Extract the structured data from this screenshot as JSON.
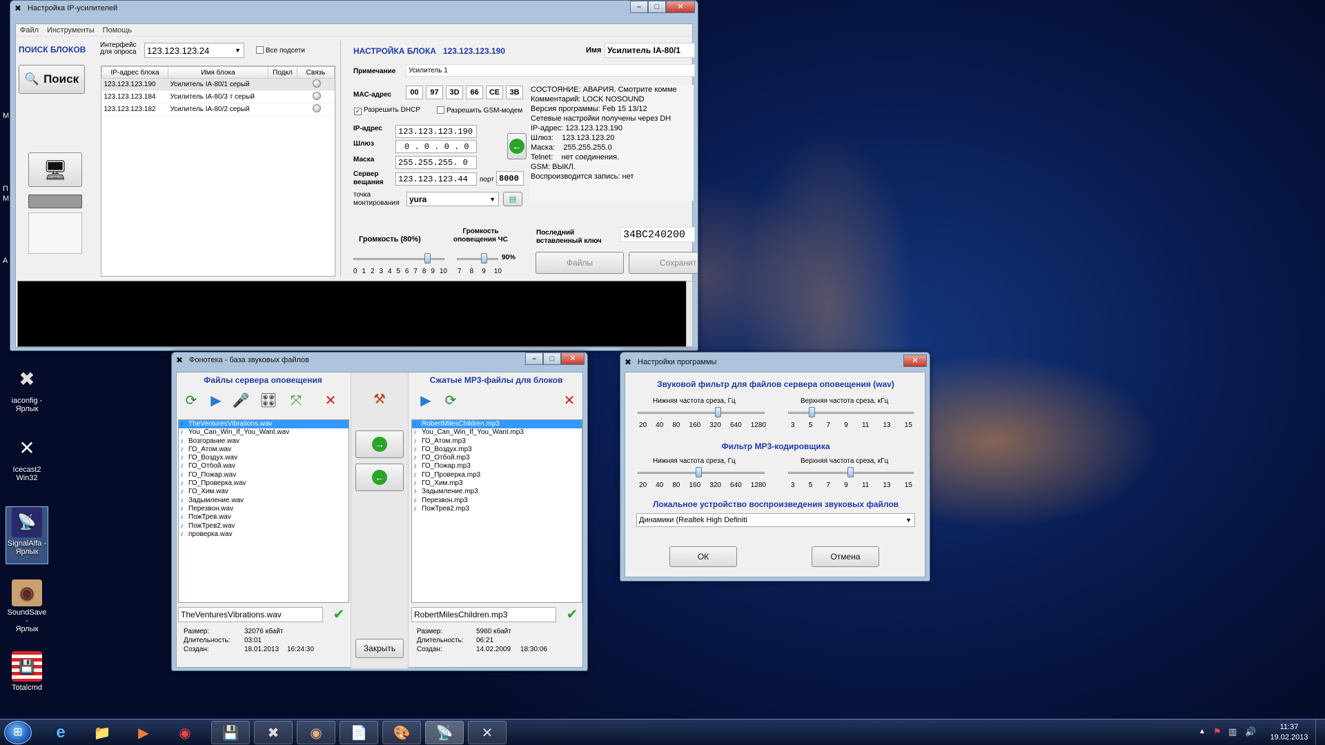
{
  "desktop": {
    "icons": [
      {
        "label1": "iaconfig -",
        "label2": "Ярлык"
      },
      {
        "label1": "Icecast2",
        "label2": "Win32"
      },
      {
        "label1": "SignalAlfa -",
        "label2": "Ярлык"
      },
      {
        "label1": "SoundSave -",
        "label2": "Ярлык"
      },
      {
        "label1": "Totalcmd",
        "label2": ""
      }
    ],
    "edge_letters": [
      "M",
      "П",
      "M",
      "A"
    ]
  },
  "main": {
    "title": "Настройка IP-усилителей",
    "menu": [
      "Файл",
      "Инструменты",
      "Помощь"
    ],
    "search_title": "ПОИСК БЛОКОВ",
    "iface_label1": "Интерфейс",
    "iface_label2": "для опроса",
    "iface_value": "123.123.123.24",
    "all_subnets": "Все подсети",
    "search_button": "Поиск",
    "columns": [
      "IP-адрес блока",
      "Имя блока",
      "Подкл",
      "Связь"
    ],
    "rows": [
      {
        "ip": "123.123.123.190",
        "name": "Усилитель IA-80/1 серый"
      },
      {
        "ip": "123.123.123.184",
        "name": "Усилитель IA-80/3 т серый"
      },
      {
        "ip": "123.123.123.182",
        "name": "Усилитель IA-80/2 серый"
      }
    ],
    "cfg_title": "НАСТРОЙКА БЛОКА",
    "cfg_ip": "123.123.123.190",
    "name_label": "Имя",
    "name_value": "Усилитель IA-80/1",
    "note_label": "Примечание",
    "note_value": "Усилитель 1",
    "mac_label": "MAC-адрес",
    "mac": [
      "00",
      "97",
      "3D",
      "66",
      "CE",
      "3B"
    ],
    "dhcp_label": "Разрешить DHCP",
    "gsm_label": "Разрешить GSM-модем",
    "ip_label": "IP-адрес",
    "ip_value": "123.123.123.190",
    "gw_label": "Шлюз",
    "gw_value": "0 . 0 . 0 . 0",
    "mask_label": "Маска",
    "mask_value": "255.255.255. 0",
    "server_label1": "Сервер",
    "server_label2": "вещания",
    "server_value": "123.123.123.44",
    "port_label": "порт",
    "port_value": "8000",
    "mount_label1": "точка",
    "mount_label2": "монтирования",
    "mount_value": "yura",
    "status_lines": [
      "СОСТОЯНИЕ: АВАРИЯ. Смотрите комме",
      "Комментарий: LOCK NOSOUND",
      "Версия программы: Feb 15 13/12",
      "Сетевые настройки получены через DH",
      "IP-адрес: 123.123.123.190",
      "Шлюз:    123.123.123.20",
      "Маска:    255.255.255.0",
      "Telnet:    нет соединения.",
      "GSM: ВЫКЛ.",
      "Воспроизводится запись: нет"
    ],
    "volume_label": "Громкость (80%)",
    "volume_pct": 80,
    "volume_ticks": [
      "0",
      "1",
      "2",
      "3",
      "4",
      "5",
      "6",
      "7",
      "8",
      "9",
      "10"
    ],
    "emerg_label1": "Громкость",
    "emerg_label2": "оповещения ЧС",
    "emerg_pct": "90%",
    "emerg_ticks": [
      "7",
      "8",
      "9",
      "10"
    ],
    "key_label1": "Последний",
    "key_label2": "вставленный ключ",
    "key_value": "34BC240200",
    "files_button": "Файлы",
    "save_button": "Сохранит"
  },
  "phono": {
    "title": "Фонотека - база звуковых файлов",
    "left_title": "Файлы сервера оповещения",
    "right_title": "Сжатые МР3-файлы для блоков",
    "left_files": [
      "TheVenturesVibrations.wav",
      "You_Can_Win_If_You_Want.wav",
      "Возгорание.wav",
      "ГО_Атом.wav",
      "ГО_Воздух.wav",
      "ГО_Отбой.wav",
      "ГО_Пожар.wav",
      "ГО_Проверка.wav",
      "ГО_Хим.wav",
      "Задымление.wav",
      "Перезвон.wav",
      "ПожТрев.wav",
      "ПожТрев2.wav",
      "проверка.wav"
    ],
    "right_files": [
      "RobertMilesChildren.mp3",
      "You_Can_Win_If_You_Want.mp3",
      "ГО_Атом.mp3",
      "ГО_Воздух.mp3",
      "ГО_Отбой.mp3",
      "ГО_Пожар.mp3",
      "ГО_Проверка.mp3",
      "ГО_Хим.mp3",
      "Задымление.mp3",
      "Перезвон.mp3",
      "ПожТрев2.mp3"
    ],
    "left_name": "TheVenturesVibrations.wav",
    "right_name": "RobertMilesChildren.mp3",
    "size_label": "Размер:",
    "dur_label": "Длительность:",
    "created_label": "Создан:",
    "left_size": "32076 кбайт",
    "left_dur": "03:01",
    "left_date": "18.01.2013",
    "left_time": "16:24:30",
    "right_size": "5960 кбайт",
    "right_dur": "06:21",
    "right_date": "14.02.2009",
    "right_time": "18:30:06",
    "close_button": "Закрыть"
  },
  "settings": {
    "title": "Настройки программы",
    "wav_title": "Звуковой фильтр для файлов сервера оповещения (wav)",
    "mp3_title": "Фильтр МР3-кодировщика",
    "low_label": "Нижняя частота среза, Гц",
    "high_label": "Верхняя частота среза, кГц",
    "low_ticks": [
      "20",
      "40",
      "80",
      "160",
      "320",
      "640",
      "1280"
    ],
    "high_ticks": [
      "3",
      "5",
      "7",
      "9",
      "11",
      "13",
      "15"
    ],
    "wav_low": "320",
    "wav_high": "5",
    "mp3_low": "160",
    "mp3_high": "9",
    "device_title": "Локальное устройство воспроизведения звуковых файлов",
    "device_value": "Динамики (Realtek High Definiti",
    "ok_button": "ОК",
    "cancel_button": "Отмена"
  },
  "taskbar": {
    "time": "11:37",
    "date": "19.02.2013"
  }
}
